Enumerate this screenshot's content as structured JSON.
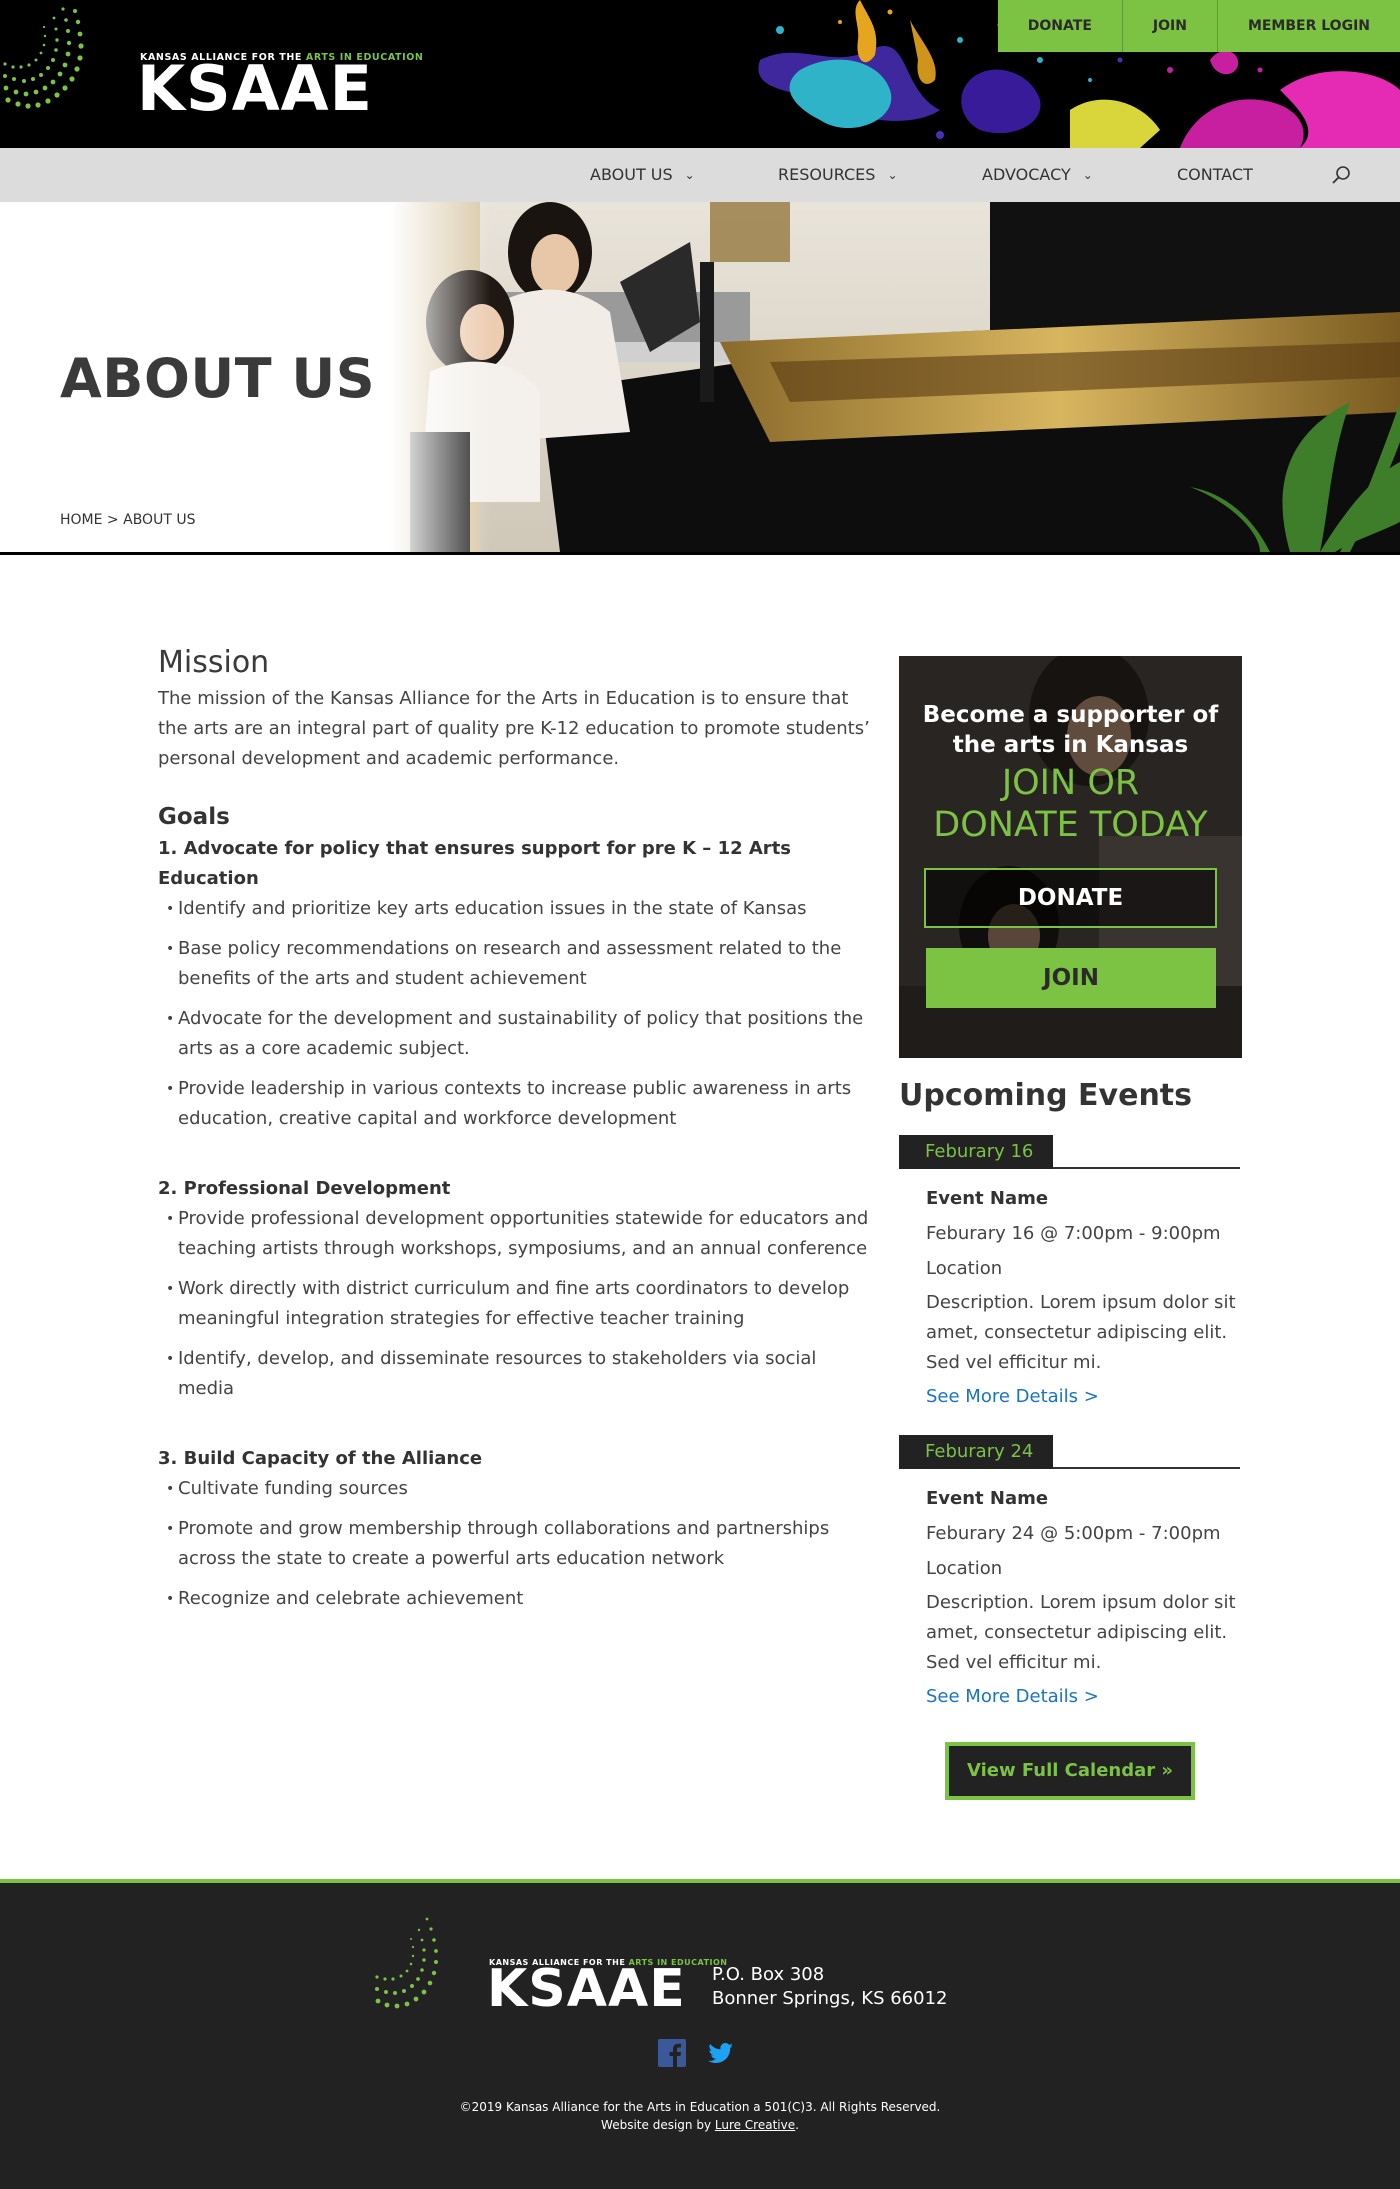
{
  "header": {
    "logo_small_prefix": "KANSAS ALLIANCE FOR THE ",
    "logo_small_accent": "ARTS IN EDUCATION",
    "logo_text": "KSAAE",
    "actions": [
      "DONATE",
      "JOIN",
      "MEMBER LOGIN"
    ]
  },
  "nav": {
    "items": [
      "ABOUT US",
      "RESOURCES",
      "ADVOCACY",
      "CONTACT"
    ],
    "chevron": "⌄"
  },
  "hero": {
    "title": "ABOUT US",
    "breadcrumb_home": "HOME",
    "breadcrumb_sep": " > ",
    "breadcrumb_current": "ABOUT US"
  },
  "main": {
    "mission_heading": "Mission",
    "mission_text": "The mission of the Kansas Alliance for the Arts in Education is to ensure that the arts are an integral part of quality pre K-12 education to promote students’ personal development and academic performance.",
    "goals_heading": "Goals",
    "goals": [
      {
        "title": "1. Advocate for policy that ensures support for pre K – 12 Arts Education",
        "items": [
          "Identify and prioritize key arts education issues in the state of Kansas",
          "Base policy recommendations on research and assessment related to the benefits of the arts and student achievement",
          "Advocate for the development and sustainability of policy that positions the arts as a core academic subject.",
          "Provide leadership in various contexts to increase public awareness in arts education, creative capital and workforce development"
        ]
      },
      {
        "title": "2. Professional Development",
        "items": [
          "Provide professional development opportunities statewide for educators and teaching artists through workshops, symposiums, and an annual conference",
          "Work directly with district curriculum and fine arts coordinators to develop meaningful integration strategies for effective teacher training",
          "Identify, develop, and disseminate resources to stakeholders via social media"
        ]
      },
      {
        "title": "3. Build Capacity of the Alliance",
        "items": [
          "Cultivate funding sources",
          "Promote and grow membership through collaborations and partnerships across the state to create a powerful arts education network",
          "Recognize and celebrate achievement"
        ]
      }
    ]
  },
  "promo": {
    "heading_line1": "Become a supporter of",
    "heading_line2": "the arts in Kansas",
    "cta_line1": "JOIN OR",
    "cta_line2": "DONATE TODAY",
    "donate_label": "DONATE",
    "join_label": "JOIN"
  },
  "events": {
    "heading": "Upcoming Events",
    "list": [
      {
        "date_tab": "Feburary 16",
        "name": "Event Name",
        "time": "Feburary 16 @ 7:00pm - 9:00pm",
        "location": "Location",
        "description": "Description. Lorem ipsum dolor sit amet, consectetur adipiscing elit. Sed vel efficitur mi.",
        "more": "See More Details >"
      },
      {
        "date_tab": "Feburary 24",
        "name": "Event Name",
        "time": "Feburary 24 @ 5:00pm - 7:00pm",
        "location": "Location",
        "description": "Description. Lorem ipsum dolor sit amet, consectetur adipiscing elit. Sed vel efficitur mi.",
        "more": "See More Details >"
      }
    ],
    "calendar_button": "View Full Calendar »"
  },
  "footer": {
    "logo_small_prefix": "KANSAS ALLIANCE FOR THE ",
    "logo_small_accent": "ARTS IN EDUCATION",
    "logo_text": "KSAAE",
    "address_line1": "P.O. Box 308",
    "address_line2": "Bonner Springs, KS 66012",
    "social": [
      "facebook-icon",
      "twitter-icon"
    ],
    "copyright": "©2019 Kansas Alliance for the Arts in Education a 501(C)3. All Rights Reserved.",
    "credit_prefix": "Website design by ",
    "credit_link": "Lure Creative",
    "credit_suffix": "."
  },
  "colors": {
    "accent_green": "#7cc243",
    "dark": "#222222",
    "link_blue": "#1a73c4"
  }
}
